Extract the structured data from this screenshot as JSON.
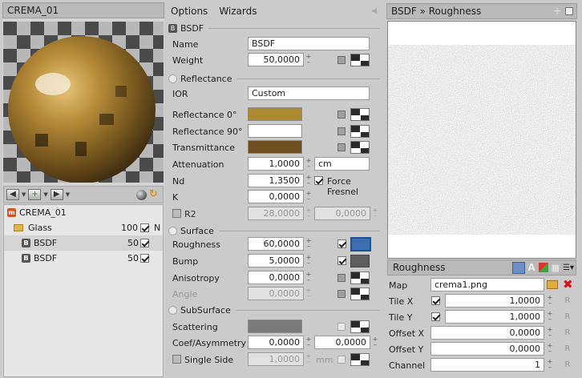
{
  "left": {
    "title": "CREMA_01",
    "tree": [
      {
        "label": "CREMA_01",
        "icon": "material-icon",
        "value": "",
        "checked": null,
        "extra": ""
      },
      {
        "label": "Glass",
        "icon": "folder-icon",
        "value": "100",
        "checked": true,
        "extra": "N"
      },
      {
        "label": "BSDF",
        "icon": "bsdf-icon",
        "value": "50",
        "checked": true,
        "extra": ""
      },
      {
        "label": "BSDF",
        "icon": "bsdf-icon",
        "value": "50",
        "checked": true,
        "extra": ""
      }
    ]
  },
  "mid": {
    "menu": {
      "options": "Options",
      "wizards": "Wizards"
    },
    "sections": {
      "bsdf": "BSDF",
      "reflectance": "Reflectance",
      "surface": "Surface",
      "subsurface": "SubSurface"
    },
    "bsdf": {
      "name_label": "Name",
      "name_value": "BSDF",
      "weight_label": "Weight",
      "weight_value": "50,0000"
    },
    "refl": {
      "ior_label": "IOR",
      "ior_value": "Custom",
      "r0_label": "Reflectance 0°",
      "r0_color": "#ad8a30",
      "r90_label": "Reflectance 90°",
      "r90_color": "#ffffff",
      "trans_label": "Transmittance",
      "trans_color": "#6e4f1f",
      "atten_label": "Attenuation",
      "atten_value": "1,0000",
      "atten_unit": "cm",
      "nd_label": "Nd",
      "nd_value": "1,3500",
      "fresnel_label": "Force Fresnel",
      "k_label": "K",
      "k_value": "0,0000",
      "r2_label": "R2",
      "r2_value": "28,0000",
      "r2_value2": "0,0000"
    },
    "surf": {
      "rough_label": "Roughness",
      "rough_value": "60,0000",
      "bump_label": "Bump",
      "bump_value": "5,0000",
      "aniso_label": "Anisotropy",
      "aniso_value": "0,0000",
      "angle_label": "Angle",
      "angle_value": "0,0000"
    },
    "sub": {
      "scat_label": "Scattering",
      "coef_label": "Coef/Asymmetry",
      "coef_value": "0,0000",
      "coef_value2": "0,0000",
      "single_label": "Single Side",
      "single_value": "1,0000",
      "single_unit": "mm"
    }
  },
  "right": {
    "title": "BSDF » Roughness",
    "sub_title": "Roughness",
    "map_label": "Map",
    "map_value": "crema1.png",
    "tilex_label": "Tile X",
    "tilex_value": "1,0000",
    "tiley_label": "Tile Y",
    "tiley_value": "1,0000",
    "offx_label": "Offset X",
    "offx_value": "0,0000",
    "offy_label": "Offset Y",
    "offy_value": "0,0000",
    "chan_label": "Channel",
    "chan_value": "1"
  }
}
